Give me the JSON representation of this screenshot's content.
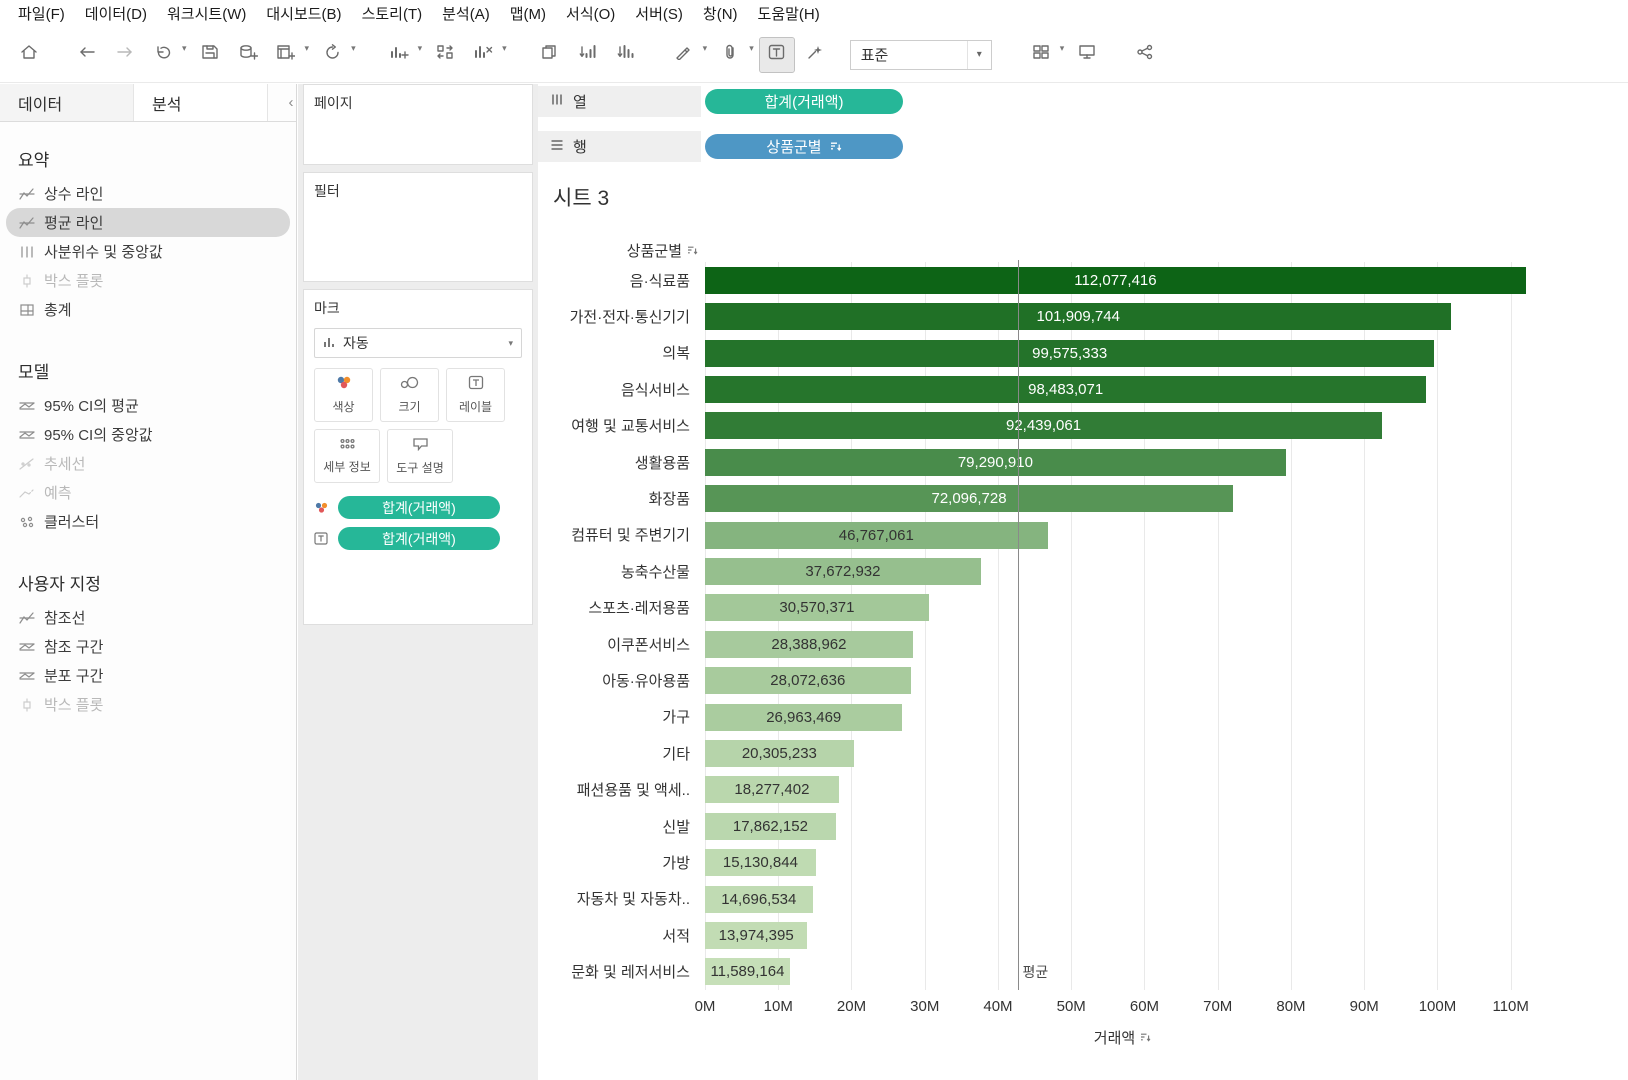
{
  "menu": {
    "items": [
      "파일(F)",
      "데이터(D)",
      "워크시트(W)",
      "대시보드(B)",
      "스토리(T)",
      "분석(A)",
      "맵(M)",
      "서식(O)",
      "서버(S)",
      "창(N)",
      "도움말(H)"
    ]
  },
  "toolbar": {
    "fit_label": "표준"
  },
  "icons": {
    "caret": "▾",
    "collapse_pane": "‹"
  },
  "colors": {
    "pill_green": "#26b798",
    "pill_blue": "#4e97c5",
    "selection_gray": "#d8d8d8"
  },
  "left_panel": {
    "tabs": [
      {
        "label": "데이터"
      },
      {
        "label": "분석"
      }
    ],
    "active_tab": "분석",
    "sections": [
      {
        "title": "요약",
        "items": [
          {
            "label": "상수 라인",
            "icon": "constant-line-icon",
            "type": "line"
          },
          {
            "label": "평균 라인",
            "icon": "average-line-icon",
            "type": "line",
            "selected": true
          },
          {
            "label": "사분위수 및 중앙값",
            "icon": "quartiles-median-icon",
            "type": "quartile"
          },
          {
            "label": "박스 플롯",
            "icon": "box-plot-icon",
            "type": "box",
            "disabled": true
          },
          {
            "label": "총계",
            "icon": "totals-icon",
            "type": "totals"
          }
        ]
      },
      {
        "title": "모델",
        "items": [
          {
            "label": "95% CI의 평균",
            "icon": "average-ci-icon",
            "type": "band"
          },
          {
            "label": "95% CI의 중앙값",
            "icon": "median-ci-icon",
            "type": "band"
          },
          {
            "label": "추세선",
            "icon": "trend-line-icon",
            "type": "trend",
            "disabled": true
          },
          {
            "label": "예측",
            "icon": "forecast-icon",
            "type": "forecast",
            "disabled": true
          },
          {
            "label": "클러스터",
            "icon": "cluster-icon",
            "type": "cluster"
          }
        ]
      },
      {
        "title": "사용자 지정",
        "items": [
          {
            "label": "참조선",
            "icon": "reference-line-icon",
            "type": "line"
          },
          {
            "label": "참조 구간",
            "icon": "reference-band-icon",
            "type": "band"
          },
          {
            "label": "분포 구간",
            "icon": "distribution-band-icon",
            "type": "band"
          },
          {
            "label": "박스 플롯",
            "icon": "box-plot-icon",
            "type": "box",
            "disabled": true
          }
        ]
      }
    ]
  },
  "cards": {
    "pages": {
      "title": "페이지"
    },
    "filters": {
      "title": "필터"
    },
    "marks": {
      "title": "마크",
      "mark_type": "자동",
      "buttons": [
        {
          "label": "색상",
          "icon": "color-icon"
        },
        {
          "label": "크기",
          "icon": "size-icon"
        },
        {
          "label": "레이블",
          "icon": "label-icon"
        },
        {
          "label": "세부 정보",
          "icon": "detail-icon"
        },
        {
          "label": "도구 설명",
          "icon": "tooltip-icon"
        }
      ],
      "pills": [
        {
          "icon": "color-icon",
          "label": "합계(거래액)"
        },
        {
          "icon": "label-icon",
          "label": "합계(거래액)"
        }
      ]
    }
  },
  "shelves": {
    "columns_label": "열",
    "rows_label": "행",
    "columns_pill": {
      "label": "합계(거래액)"
    },
    "rows_pill": {
      "label": "상품군별",
      "sorted": "desc"
    }
  },
  "sheet": {
    "title": "시트 3"
  },
  "chart_data": {
    "type": "bar",
    "orientation": "horizontal",
    "title": "시트 3",
    "category_field": "상품군별",
    "value_field": "거래액",
    "categories": [
      "음·식료품",
      "가전·전자·통신기기",
      "의복",
      "음식서비스",
      "여행 및 교통서비스",
      "생활용품",
      "화장품",
      "컴퓨터 및 주변기기",
      "농축수산물",
      "스포츠·레저용품",
      "이쿠폰서비스",
      "아동·유아용품",
      "가구",
      "기타",
      "패션용품 및 액세..",
      "신발",
      "가방",
      "자동차 및 자동차..",
      "서적",
      "문화 및 레저서비스"
    ],
    "values": [
      112077416,
      101909744,
      99575333,
      98483071,
      92439061,
      79290910,
      72096728,
      46767061,
      37672932,
      30570371,
      28388962,
      28072636,
      26963469,
      20305233,
      18277402,
      17862152,
      15130844,
      14696534,
      13974395,
      11589164
    ],
    "value_labels": [
      "112,077,416",
      "101,909,744",
      "99,575,333",
      "98,483,071",
      "92,439,061",
      "79,290,910",
      "72,096,728",
      "46,767,061",
      "37,672,932",
      "30,570,371",
      "28,388,962",
      "28,072,636",
      "26,963,469",
      "20,305,233",
      "18,277,402",
      "17,862,152",
      "15,130,844",
      "14,696,534",
      "13,974,395",
      "11,589,164"
    ],
    "x_ticks": [
      "0M",
      "10M",
      "20M",
      "30M",
      "40M",
      "50M",
      "60M",
      "70M",
      "80M",
      "90M",
      "100M",
      "110M"
    ],
    "x_tick_values": [
      0,
      10000000,
      20000000,
      30000000,
      40000000,
      50000000,
      60000000,
      70000000,
      80000000,
      90000000,
      100000000,
      110000000
    ],
    "xlim": [
      0,
      114000000
    ],
    "xlabel": "거래액",
    "grid": true,
    "reference_line": {
      "label": "평균",
      "value": 42800000
    },
    "color_scale": {
      "light": "#c6dfb8",
      "dark": "#0d6416"
    }
  }
}
